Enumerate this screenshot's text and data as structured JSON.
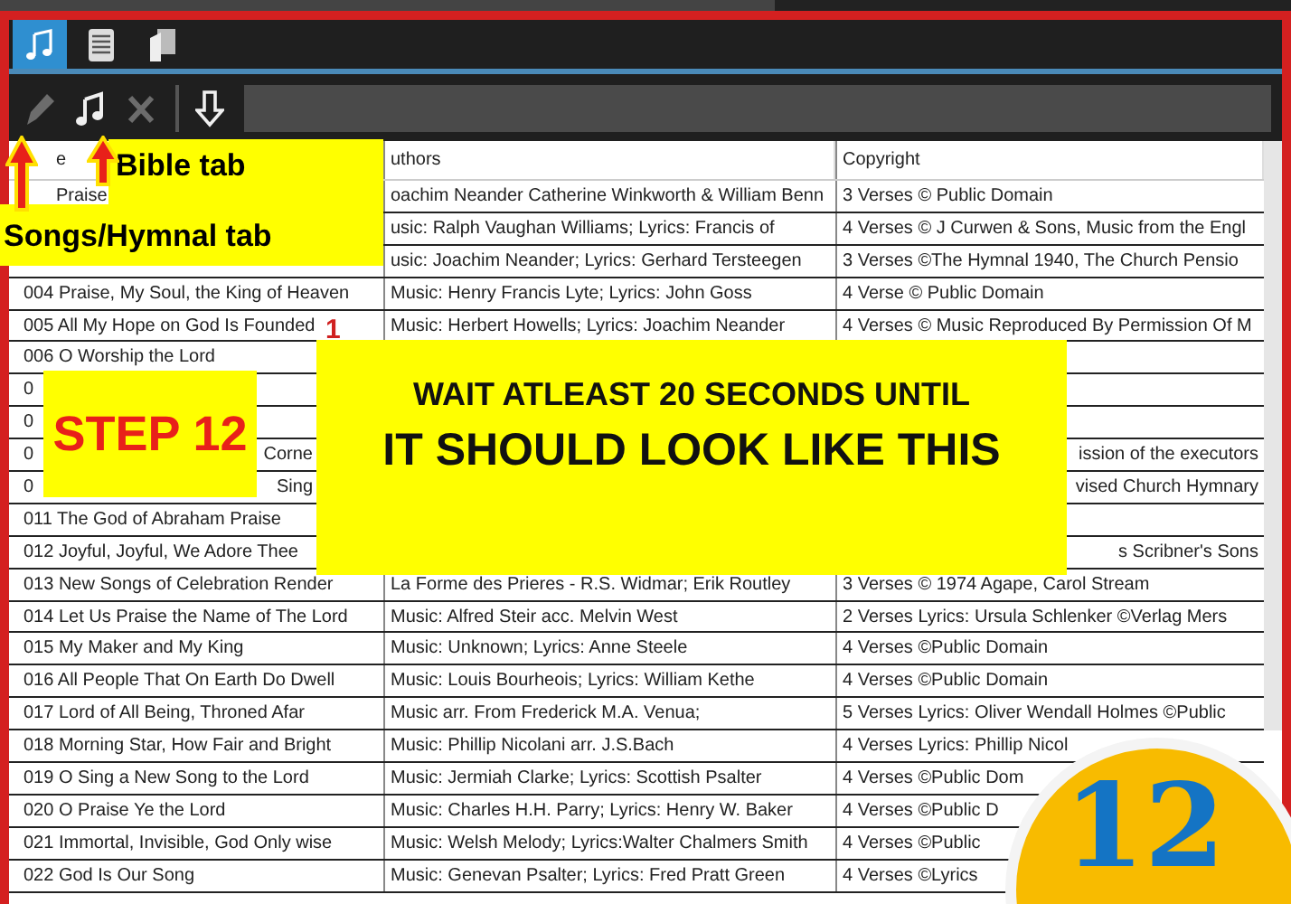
{
  "tabs": [
    {
      "kind": "music",
      "selected": true
    },
    {
      "kind": "book",
      "selected": false
    },
    {
      "kind": "pages",
      "selected": false
    }
  ],
  "toolbar": [
    {
      "kind": "edit",
      "disabled": true
    },
    {
      "kind": "add-song",
      "disabled": false
    },
    {
      "kind": "delete",
      "disabled": true
    },
    {
      "kind": "import",
      "disabled": false
    }
  ],
  "table": {
    "columns": [
      "e",
      "uthors",
      "Copyright"
    ],
    "rows": [
      {
        "title": "Praise",
        "authors": "oachim Neander Catherine Winkworth & William Benn",
        "copyright": "3 Verses   © Public Domain"
      },
      {
        "authors": "usic: Ralph Vaughan Williams; Lyrics: Francis of",
        "copyright": "4 Verses  © J Curwen & Sons, Music from the Engl"
      },
      {
        "authors": "usic: Joachim Neander; Lyrics: Gerhard Tersteegen",
        "copyright": "3 Verses  ©The Hymnal 1940, The Church Pensio"
      },
      {
        "title": "004 Praise, My Soul, the King of Heaven",
        "authors": "Music: Henry Francis Lyte; Lyrics: John Goss",
        "copyright": "4 Verse   © Public Domain"
      },
      {
        "title": "005 All My Hope on God Is Founded",
        "authors": "Music: Herbert Howells; Lyrics: Joachim Neander",
        "copyright": "4 Verses  © Music Reproduced By Permission Of M"
      },
      {
        "title": "006 O Worship the Lord"
      },
      {
        "title": "0"
      },
      {
        "title": "0"
      },
      {
        "title": "0",
        "title_tail": "Corne",
        "copyright_tail": "ission of the executors"
      },
      {
        "title": "0",
        "title_tail": "Sing",
        "copyright_tail": "vised Church Hymnary"
      },
      {
        "title": "011 The God of Abraham Praise"
      },
      {
        "title": "012 Joyful, Joyful, We Adore Thee",
        "copyright_tail": "s Scribner's Sons"
      },
      {
        "title": "013 New Songs of Celebration Render",
        "authors": "La Forme des Prieres - R.S. Widmar; Erik Routley",
        "copyright": "3 Verses   © 1974 Agape, Carol Stream"
      },
      {
        "title": "014 Let Us Praise the Name of The Lord",
        "authors": "Music: Alfred Steir acc. Melvin West",
        "copyright": "2 Verses   Lyrics: Ursula Schlenker   ©Verlag Mers"
      },
      {
        "title": "015 My Maker and My King",
        "authors": "Music: Unknown; Lyrics: Anne Steele",
        "copyright": "4 Verses   ©Public Domain"
      },
      {
        "title": "016 All People That On Earth Do Dwell",
        "authors": "Music: Louis Bourheois; Lyrics: William Kethe",
        "copyright": "4 Verses   ©Public Domain"
      },
      {
        "title": "017 Lord of All Being, Throned Afar",
        "authors": "Music arr. From Frederick M.A. Venua;",
        "copyright": "5 Verses   Lyrics: Oliver Wendall Holmes   ©Public"
      },
      {
        "title": "018 Morning Star, How Fair and Bright",
        "authors": "Music: Phillip Nicolani arr. J.S.Bach",
        "copyright": "4 Verses   Lyrics: Phillip Nicol"
      },
      {
        "title": "019 O Sing a New Song to the Lord",
        "authors": "Music: Jermiah Clarke; Lyrics: Scottish Psalter",
        "copyright": "4 Verses   ©Public Dom"
      },
      {
        "title": "020 O Praise Ye the Lord",
        "authors": "Music: Charles H.H. Parry; Lyrics:  Henry W. Baker",
        "copyright": "4 Verses   ©Public D"
      },
      {
        "title": "021 Immortal, Invisible, God Only wise",
        "authors": "Music: Welsh Melody; Lyrics:Walter Chalmers Smith",
        "copyright": "4 Verses   ©Public"
      },
      {
        "title": "022 God Is Our Song",
        "authors": "Music: Genevan Psalter; Lyrics:  Fred Pratt Green",
        "copyright": "4 Verses   ©Lyrics"
      }
    ]
  },
  "annotations": {
    "bible_label": "Bible tab",
    "songs_label": "Songs/Hymnal tab",
    "step": "STEP 12",
    "marker": "1",
    "message": [
      "WAIT ATLEAST 20 SECONDS UNTIL",
      "IT SHOULD LOOK LIKE THIS"
    ],
    "badge": "12"
  }
}
